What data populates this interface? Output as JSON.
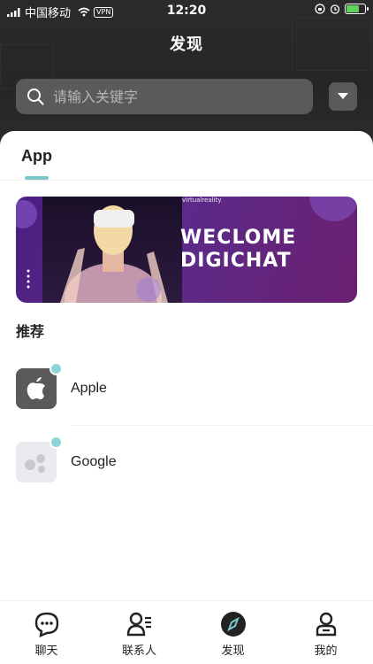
{
  "status_bar": {
    "carrier": "中国移动",
    "vpn": "VPN",
    "time": "12:20"
  },
  "header": {
    "title": "发现"
  },
  "search": {
    "placeholder": "请输入关键字"
  },
  "tabs": [
    {
      "label": "App",
      "selected": true
    }
  ],
  "banner": {
    "brand": "virtualreality",
    "line1": "WECLOME",
    "line2": "DIGICHAT"
  },
  "recommend": {
    "title": "推荐",
    "apps": [
      {
        "name": "Apple",
        "icon": "apple-logo-icon"
      },
      {
        "name": "Google",
        "icon": "google-dots-icon"
      }
    ]
  },
  "bottom_nav": [
    {
      "label": "聊天",
      "icon": "chat-bubble-icon"
    },
    {
      "label": "联系人",
      "icon": "contacts-icon"
    },
    {
      "label": "发现",
      "icon": "compass-icon",
      "active": true
    },
    {
      "label": "我的",
      "icon": "profile-icon"
    }
  ],
  "colors": {
    "accent": "#7ac7c9",
    "header_bg": "#2b2b2b",
    "banner_bg": "#5b2a8a"
  }
}
